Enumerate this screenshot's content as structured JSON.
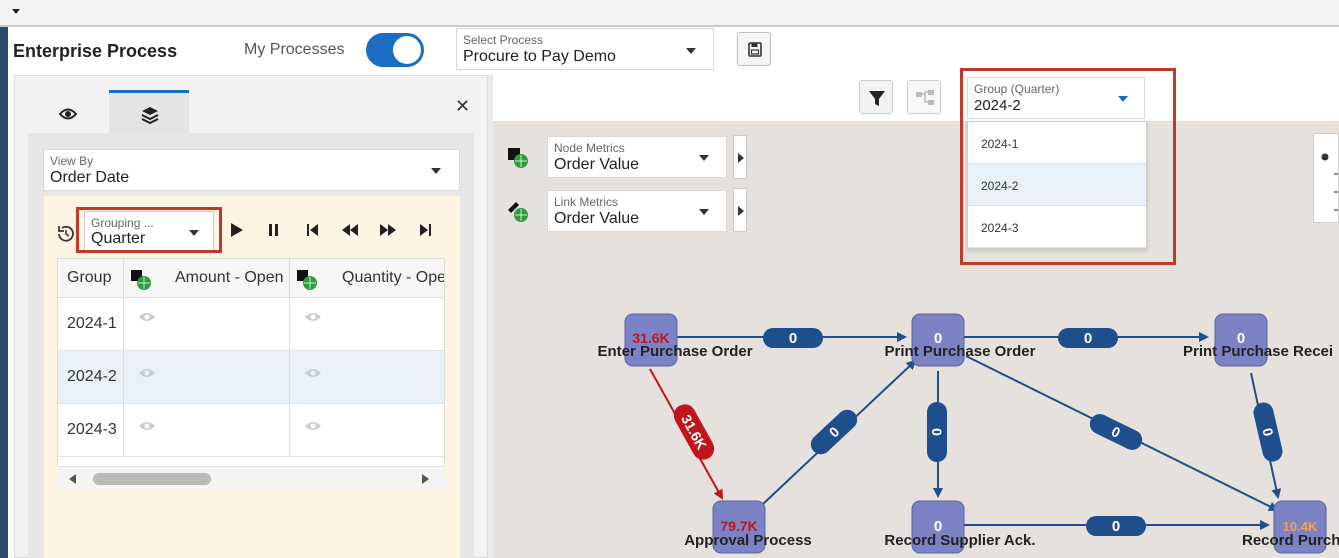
{
  "header": {
    "title": "Enterprise Process",
    "my_processes_label": "My Processes",
    "select_process_label": "Select Process",
    "select_process_value": "Procure to Pay Demo"
  },
  "left_panel": {
    "view_by_label": "View By",
    "view_by_value": "Order Date",
    "grouping_label": "Grouping ...",
    "grouping_value": "Quarter",
    "grid": {
      "columns": [
        "Group",
        "Amount - Open",
        "Quantity - Ope"
      ],
      "rows": [
        {
          "group": "2024-1"
        },
        {
          "group": "2024-2"
        },
        {
          "group": "2024-3"
        }
      ]
    }
  },
  "metrics": {
    "node_label": "Node Metrics",
    "node_value": "Order Value",
    "link_label": "Link Metrics",
    "link_value": "Order Value"
  },
  "group_select": {
    "label": "Group (Quarter)",
    "value": "2024-2",
    "options": [
      "2024-1",
      "2024-2",
      "2024-3"
    ]
  },
  "process_map": {
    "nodes": [
      {
        "name": "Enter Purchase Order",
        "value": "31.6K"
      },
      {
        "name": "Print Purchase Order",
        "value": "0"
      },
      {
        "name": "Print Purchase Recei",
        "value": "0"
      },
      {
        "name": "Approval Process",
        "value": "79.7K"
      },
      {
        "name": "Record Supplier Ack.",
        "value": "0"
      },
      {
        "name": "Record Purch",
        "value": "10.4K"
      }
    ],
    "links": [
      {
        "label": "0"
      },
      {
        "label": "0"
      },
      {
        "label": "31.6K"
      },
      {
        "label": "0"
      },
      {
        "label": "0"
      },
      {
        "label": "0"
      },
      {
        "label": "0"
      },
      {
        "label": "0"
      }
    ]
  },
  "colors": {
    "accent": "#1b6ec2",
    "highlight_frame": "#c0392b",
    "node_fill": "#7b83c4",
    "link_fill": "#1f4e8c",
    "hot_link": "#c0161b",
    "warm_value": "#f7a24b"
  }
}
